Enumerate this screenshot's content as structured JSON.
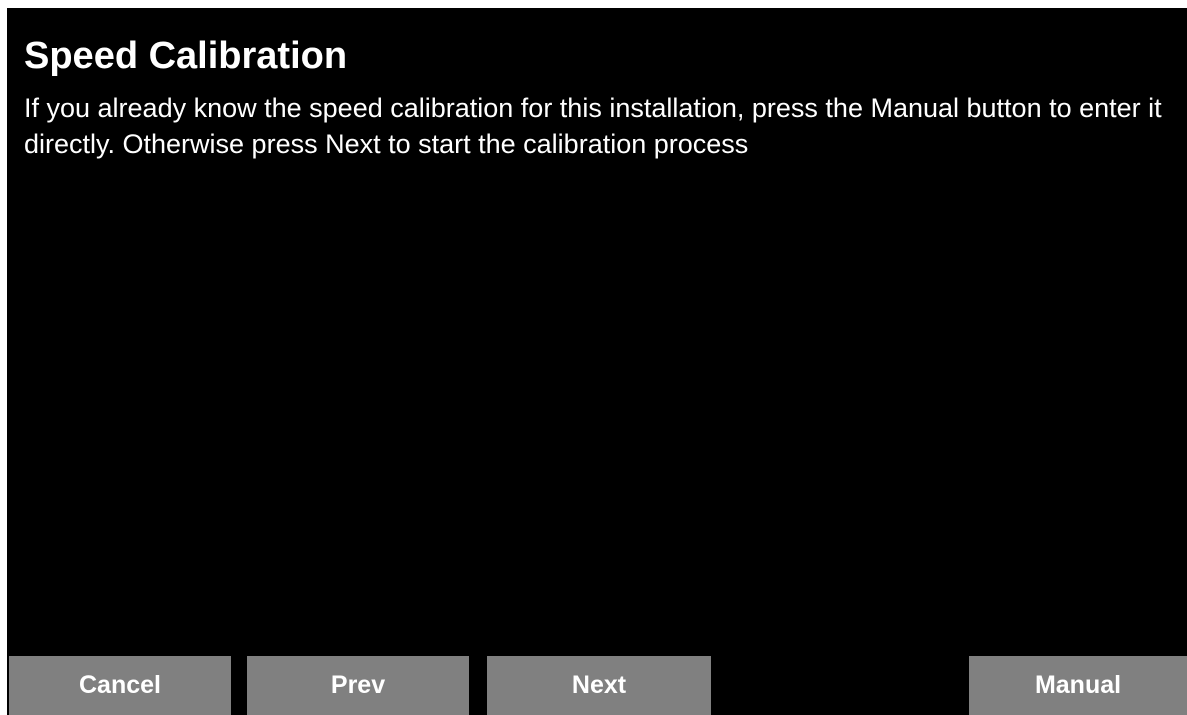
{
  "screen": {
    "title": "Speed Calibration",
    "instructions": "If you already know the speed calibration for this installation, press the Manual button to enter it directly. Otherwise press Next to start the calibration process"
  },
  "buttons": {
    "cancel": "Cancel",
    "prev": "Prev",
    "next": "Next",
    "manual": "Manual"
  },
  "colors": {
    "background": "#000000",
    "text": "#ffffff",
    "button": "#808080"
  }
}
